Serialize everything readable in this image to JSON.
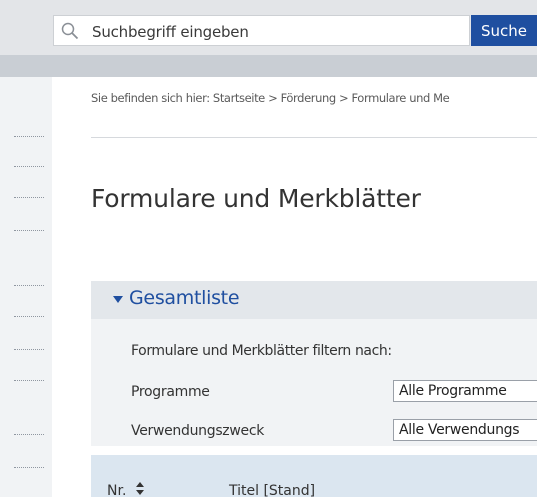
{
  "search": {
    "placeholder": "Suchbegriff eingeben",
    "button_label": "Suche"
  },
  "breadcrumb": "Sie befinden sich hier: Startseite > Förderung > Formulare und Me",
  "page_title": "Formulare und Merkblätter",
  "accordion": {
    "label": "Gesamtliste"
  },
  "filter": {
    "heading": "Formulare und Merkblätter filtern nach:",
    "programme_label": "Programme",
    "programme_value": "Alle Programme",
    "zweck_label": "Verwendungszweck",
    "zweck_value": "Alle Verwendungs"
  },
  "table": {
    "columns": [
      "Nr.",
      "Titel [Stand]"
    ]
  },
  "colors": {
    "accent": "#1f4fa0",
    "topbar": "#e3e5e8",
    "stripe": "#c9ced4",
    "panel": "#f1f3f5",
    "table_header": "#dbe6f0"
  }
}
